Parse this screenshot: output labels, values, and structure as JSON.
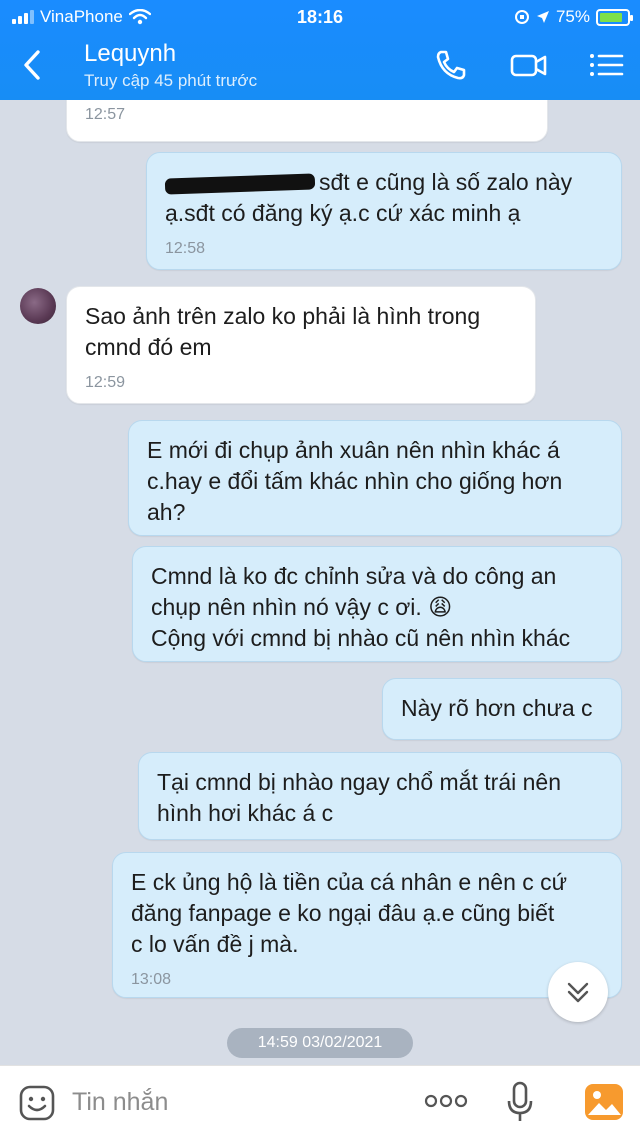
{
  "status_bar": {
    "carrier": "VinaPhone",
    "time": "18:16",
    "battery": "75%"
  },
  "header": {
    "contact_name": "Lequynh",
    "last_seen": "Truy cập 45 phút trước"
  },
  "messages": [
    {
      "sender": "contact",
      "text": "",
      "time": "12:57"
    },
    {
      "sender": "me",
      "text": "sđt e cũng là số zalo này",
      "text2": "ạ.sđt có đăng ký ạ.c cứ xác minh ạ",
      "time": "12:58"
    },
    {
      "sender": "contact",
      "text": "Sao ảnh trên zalo ko phải là hình trong",
      "text2": "cmnd đó em",
      "time": "12:59"
    },
    {
      "sender": "me",
      "text": "E mới đi chụp ảnh xuân nên nhìn khác á",
      "text2": "c.hay e đổi tấm khác nhìn cho giống hơn",
      "text3": "ah?"
    },
    {
      "sender": "me",
      "text": "Cmnd là ko đc chỉnh sửa và do công an",
      "text2": "chụp nên nhìn nó vậy c ơi. 😩",
      "text3": "Cộng với cmnd bị nhào cũ nên nhìn khác"
    },
    {
      "sender": "me",
      "text": "Này rõ hơn chưa c"
    },
    {
      "sender": "me",
      "text": "Tại cmnd bị nhào ngay chổ mắt trái nên",
      "text2": "hình hơi khác á c"
    },
    {
      "sender": "me",
      "text": "E ck ủng hộ là tiền của cá nhân e nên c cứ",
      "text2": "đăng fanpage e ko ngại đâu ạ.e cũng biết",
      "text3": "c lo vấn đề j mà.",
      "time": "13:08"
    }
  ],
  "date_separator": "14:59 03/02/2021",
  "input": {
    "placeholder": "Tin nhắn",
    "more_label": "ooo"
  },
  "colors": {
    "header": "#178df5",
    "outgoing_bubble": "#d6edfb",
    "incoming_bubble": "#ffffff",
    "background": "#d6dce6"
  },
  "icons": [
    "back-arrow-icon",
    "phone-icon",
    "video-call-icon",
    "menu-list-icon",
    "sticker-icon",
    "microphone-icon",
    "photo-icon",
    "scroll-down-icon"
  ]
}
